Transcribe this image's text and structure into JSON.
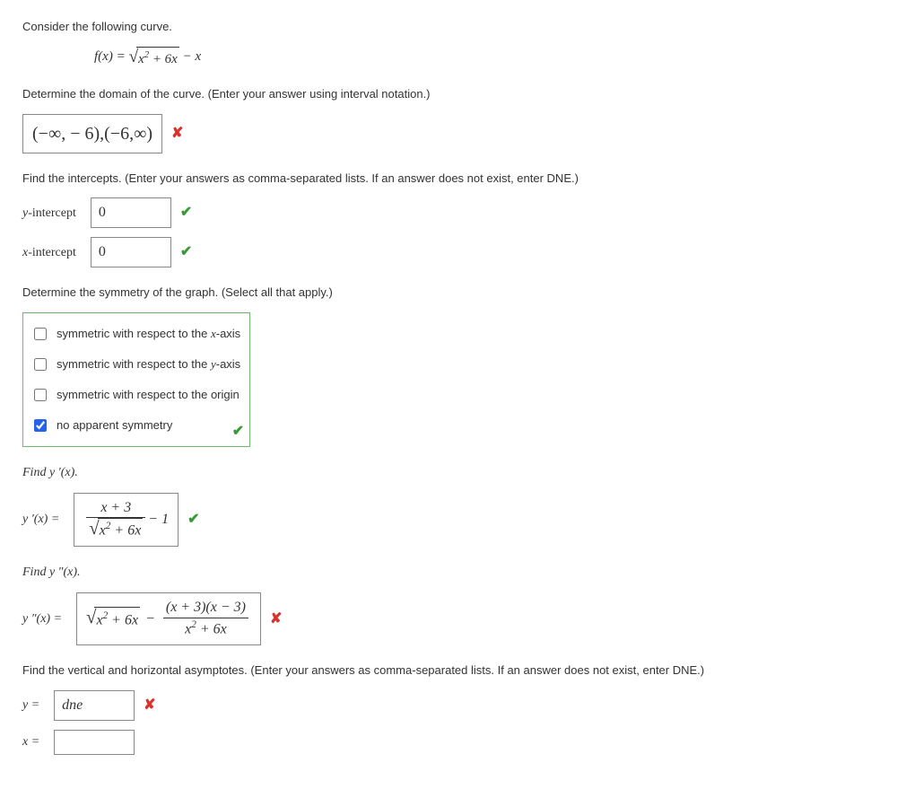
{
  "q0_prompt": "Consider the following curve.",
  "q1_prompt": "Determine the domain of the curve. (Enter your answer using interval notation.)",
  "q1_answer": "(−∞, − 6),(−6,∞)",
  "q2_prompt": "Find the intercepts. (Enter your answers as comma-separated lists. If an answer does not exist, enter DNE.)",
  "q2_yint_label": "y-intercept",
  "q2_yint_answer": "0",
  "q2_xint_label": "x-intercept",
  "q2_xint_answer": "0",
  "q3_prompt": "Determine the symmetry of the graph. (Select all that apply.)",
  "sym_opts": {
    "a_pre": "symmetric with respect to the ",
    "a_var": "x",
    "a_post": "-axis",
    "b_pre": "symmetric with respect to the ",
    "b_var": "y",
    "b_post": "-axis",
    "c": "symmetric with respect to the origin",
    "d": "no apparent symmetry"
  },
  "q4_prompt": "Find y ′(x).",
  "q4_label": "y ′(x) = ",
  "q5_prompt": "Find y ″(x).",
  "q5_label": "y ″(x) = ",
  "q6_prompt": "Find the vertical and horizontal asymptotes. (Enter your answers as comma-separated lists. If an answer does not exist, enter DNE.)",
  "q6_y_label": "y = ",
  "q6_y_answer": "dne",
  "q6_x_label": "x = ",
  "q6_x_answer": "",
  "formula": {
    "fx_lhs": "f(x) = ",
    "sqrt_inner_base": "x",
    "sqrt_inner_exp": "2",
    "sqrt_inner_tail": " + 6x",
    "tail": " − x",
    "yprime_num": "x + 3",
    "yprime_tail": " − 1",
    "y2prime_mid": " − ",
    "y2prime_top_a": "(x + 3)(x − 3)"
  }
}
